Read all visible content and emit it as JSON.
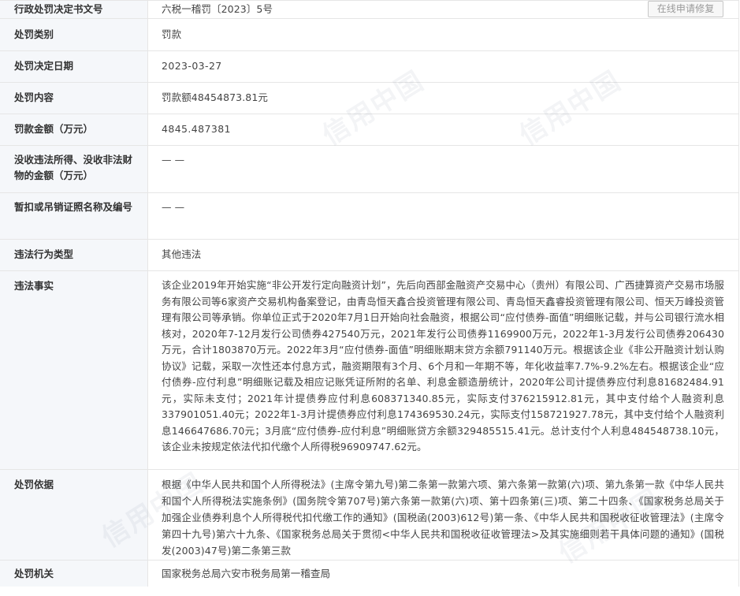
{
  "repair_button": "在线申请修复",
  "rows": [
    {
      "label": "行政处罚决定书文号",
      "value": "六税一稽罚〔2023〕5号"
    },
    {
      "label": "处罚类别",
      "value": "罚款"
    },
    {
      "label": "处罚决定日期",
      "value": "2023-03-27"
    },
    {
      "label": "处罚内容",
      "value": "罚款额48454873.81元"
    },
    {
      "label": "罚款金额（万元）",
      "value": "4845.487381"
    },
    {
      "label": "没收违法所得、没收非法财物的金额（万元）",
      "value": "— —"
    },
    {
      "label": "暂扣或吊销证照名称及编号",
      "value": "— —"
    },
    {
      "label": "违法行为类型",
      "value": "其他违法"
    },
    {
      "label": "违法事实",
      "value": "该企业2019年开始实施“非公开发行定向融资计划”，先后向西部金融资产交易中心（贵州）有限公司、广西捷算资产交易市场服务有限公司等6家资产交易机构备案登记，由青岛恒天鑫合投资管理有限公司、青岛恒天鑫睿投资管理有限公司、恒天万峰投资管理有限公司等承销。你单位正式于2020年7月1日开始向社会融资，根据公司“应付债券-面值”明细账记载，并与公司银行流水相核对，2020年7-12月发行公司债券427540万元，2021年发行公司债券1169900万元，2022年1-3月发行公司债券206430万元，合计1803870万元。2022年3月“应付债券-面值”明细账期末贷方余额791140万元。根据该企业《非公开融资计划认购协议》记载，采取一次性还本付息方式，融资期限有3个月、6个月和一年期不等，年化收益率7.7%-9.2%左右。根据该企业“应付债券-应付利息”明细账记载及相应记账凭证所附的名单、利息金额造册统计，2020年公司计提债券应付利息81682484.91元，实际未支付；2021年计提债券应付利息608371340.85元，实际支付376215912.81元，其中支付给个人融资利息337901051.40元；2022年1-3月计提债券应付利息174369530.24元，实际支付158721927.78元，其中支付给个人融资利息146647686.70元；3月底“应付债券-应付利息”明细账贷方余额329485515.41元。总计支付个人利息484548738.10元，该企业未按规定依法代扣代缴个人所得税96909747.62元。"
    },
    {
      "label": "处罚依据",
      "value": "根据《中华人民共和国个人所得税法》(主席令第九号)第二条第一款第六项、第六条第一款第(六)项、第九条第一款《中华人民共和国个人所得税法实施条例》(国务院令第707号)第六条第一款第(六)项、第十四条第(三)项、第二十四条、《国家税务总局关于加强企业债券利息个人所得税代扣代缴工作的通知》(国税函(2003)612号)第一条、《中华人民共和国税收征收管理法》(主席令第四十九号)第六十九条、《国家税务总局关于贯彻<中华人民共和国税收征收管理法>及其实施细则若干具体问题的通知》(国税发(2003)47号)第二条第三款"
    },
    {
      "label": "处罚机关",
      "value": "国家税务总局六安市税务局第一稽查局"
    }
  ],
  "watermarks": [
    "信用中国",
    "信用中国",
    "信用中国",
    "信用中国"
  ]
}
